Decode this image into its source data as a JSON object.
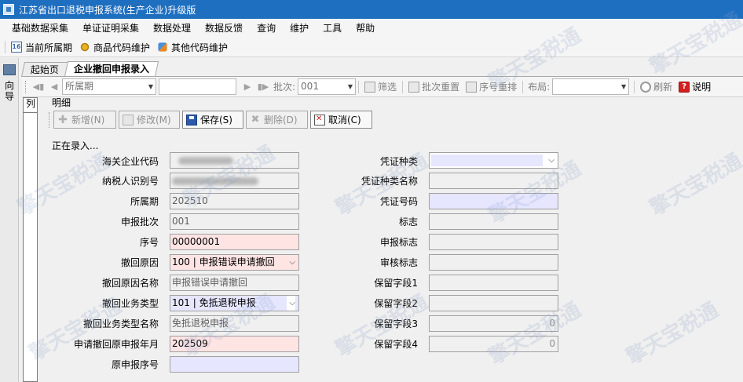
{
  "window": {
    "title": "江苏省出口退税申报系统(生产企业)升级版"
  },
  "menu": [
    "基础数据采集",
    "单证证明采集",
    "数据处理",
    "数据反馈",
    "查询",
    "维护",
    "工具",
    "帮助"
  ],
  "quickbar": {
    "items": [
      {
        "label": "当前所属期",
        "icon": "calendar-icon"
      },
      {
        "label": "商品代码维护",
        "icon": "gear-icon"
      },
      {
        "label": "其他代码维护",
        "icon": "tools-icon"
      }
    ]
  },
  "left_nav": {
    "label": "向导"
  },
  "tabs": [
    "起始页",
    "企业撤回申报录入"
  ],
  "toolbar": {
    "period_placeholder": "所属期",
    "batch_label": "批次:",
    "batch_value": "001",
    "filter": "筛选",
    "batch_reset": "批次重置",
    "seq_reorder": "序号重排",
    "layout_label": "布局:",
    "refresh": "刷新",
    "help": "说明"
  },
  "list_panel": {
    "label": "列"
  },
  "detail": {
    "title": "明细",
    "status": "正在录入...",
    "actions": {
      "add": "新增(N)",
      "edit": "修改(M)",
      "save": "保存(S)",
      "delete": "删除(D)",
      "cancel": "取消(C)"
    },
    "left_fields": [
      {
        "label": "海关企业代码",
        "value": ""
      },
      {
        "label": "纳税人识别号",
        "value": ""
      },
      {
        "label": "所属期",
        "value": "202510"
      },
      {
        "label": "申报批次",
        "value": "001"
      },
      {
        "label": "序号",
        "value": "00000001"
      },
      {
        "label": "撤回原因",
        "value": "100 | 申报错误申请撤回"
      },
      {
        "label": "撤回原因名称",
        "value": "申报错误申请撤回"
      },
      {
        "label": "撤回业务类型",
        "value": "101 | 免抵退税申报"
      },
      {
        "label": "撤回业务类型名称",
        "value": "免抵退税申报"
      },
      {
        "label": "申请撤回原申报年月",
        "value": "202509"
      },
      {
        "label": "原申报序号",
        "value": ""
      }
    ],
    "right_fields": [
      {
        "label": "凭证种类",
        "value": ""
      },
      {
        "label": "凭证种类名称",
        "value": ""
      },
      {
        "label": "凭证号码",
        "value": ""
      },
      {
        "label": "标志",
        "value": ""
      },
      {
        "label": "申报标志",
        "value": ""
      },
      {
        "label": "审核标志",
        "value": ""
      },
      {
        "label": "保留字段1",
        "value": ""
      },
      {
        "label": "保留字段2",
        "value": ""
      },
      {
        "label": "保留字段3",
        "value": "0"
      },
      {
        "label": "保留字段4",
        "value": "0"
      }
    ]
  },
  "watermark": {
    "text": "擎天宝税通"
  }
}
